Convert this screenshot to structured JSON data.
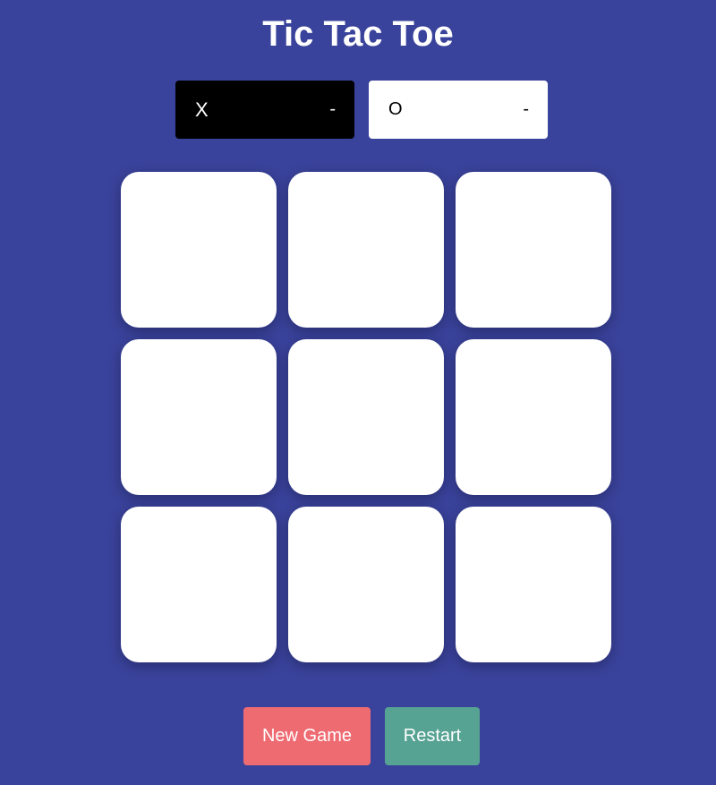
{
  "game": {
    "title": "Tic Tac Toe"
  },
  "players": {
    "x": {
      "mark": "X",
      "score": "-",
      "active": true
    },
    "o": {
      "mark": "O",
      "score": "-",
      "active": false
    }
  },
  "board": {
    "cells": [
      "",
      "",
      "",
      "",
      "",
      "",
      "",
      "",
      ""
    ]
  },
  "buttons": {
    "new_game": "New Game",
    "restart": "Restart"
  },
  "colors": {
    "background": "#3a439b",
    "active_player": "#000000",
    "inactive_player": "#ffffff",
    "new_game_button": "#ef6b72",
    "restart_button": "#57a393"
  }
}
